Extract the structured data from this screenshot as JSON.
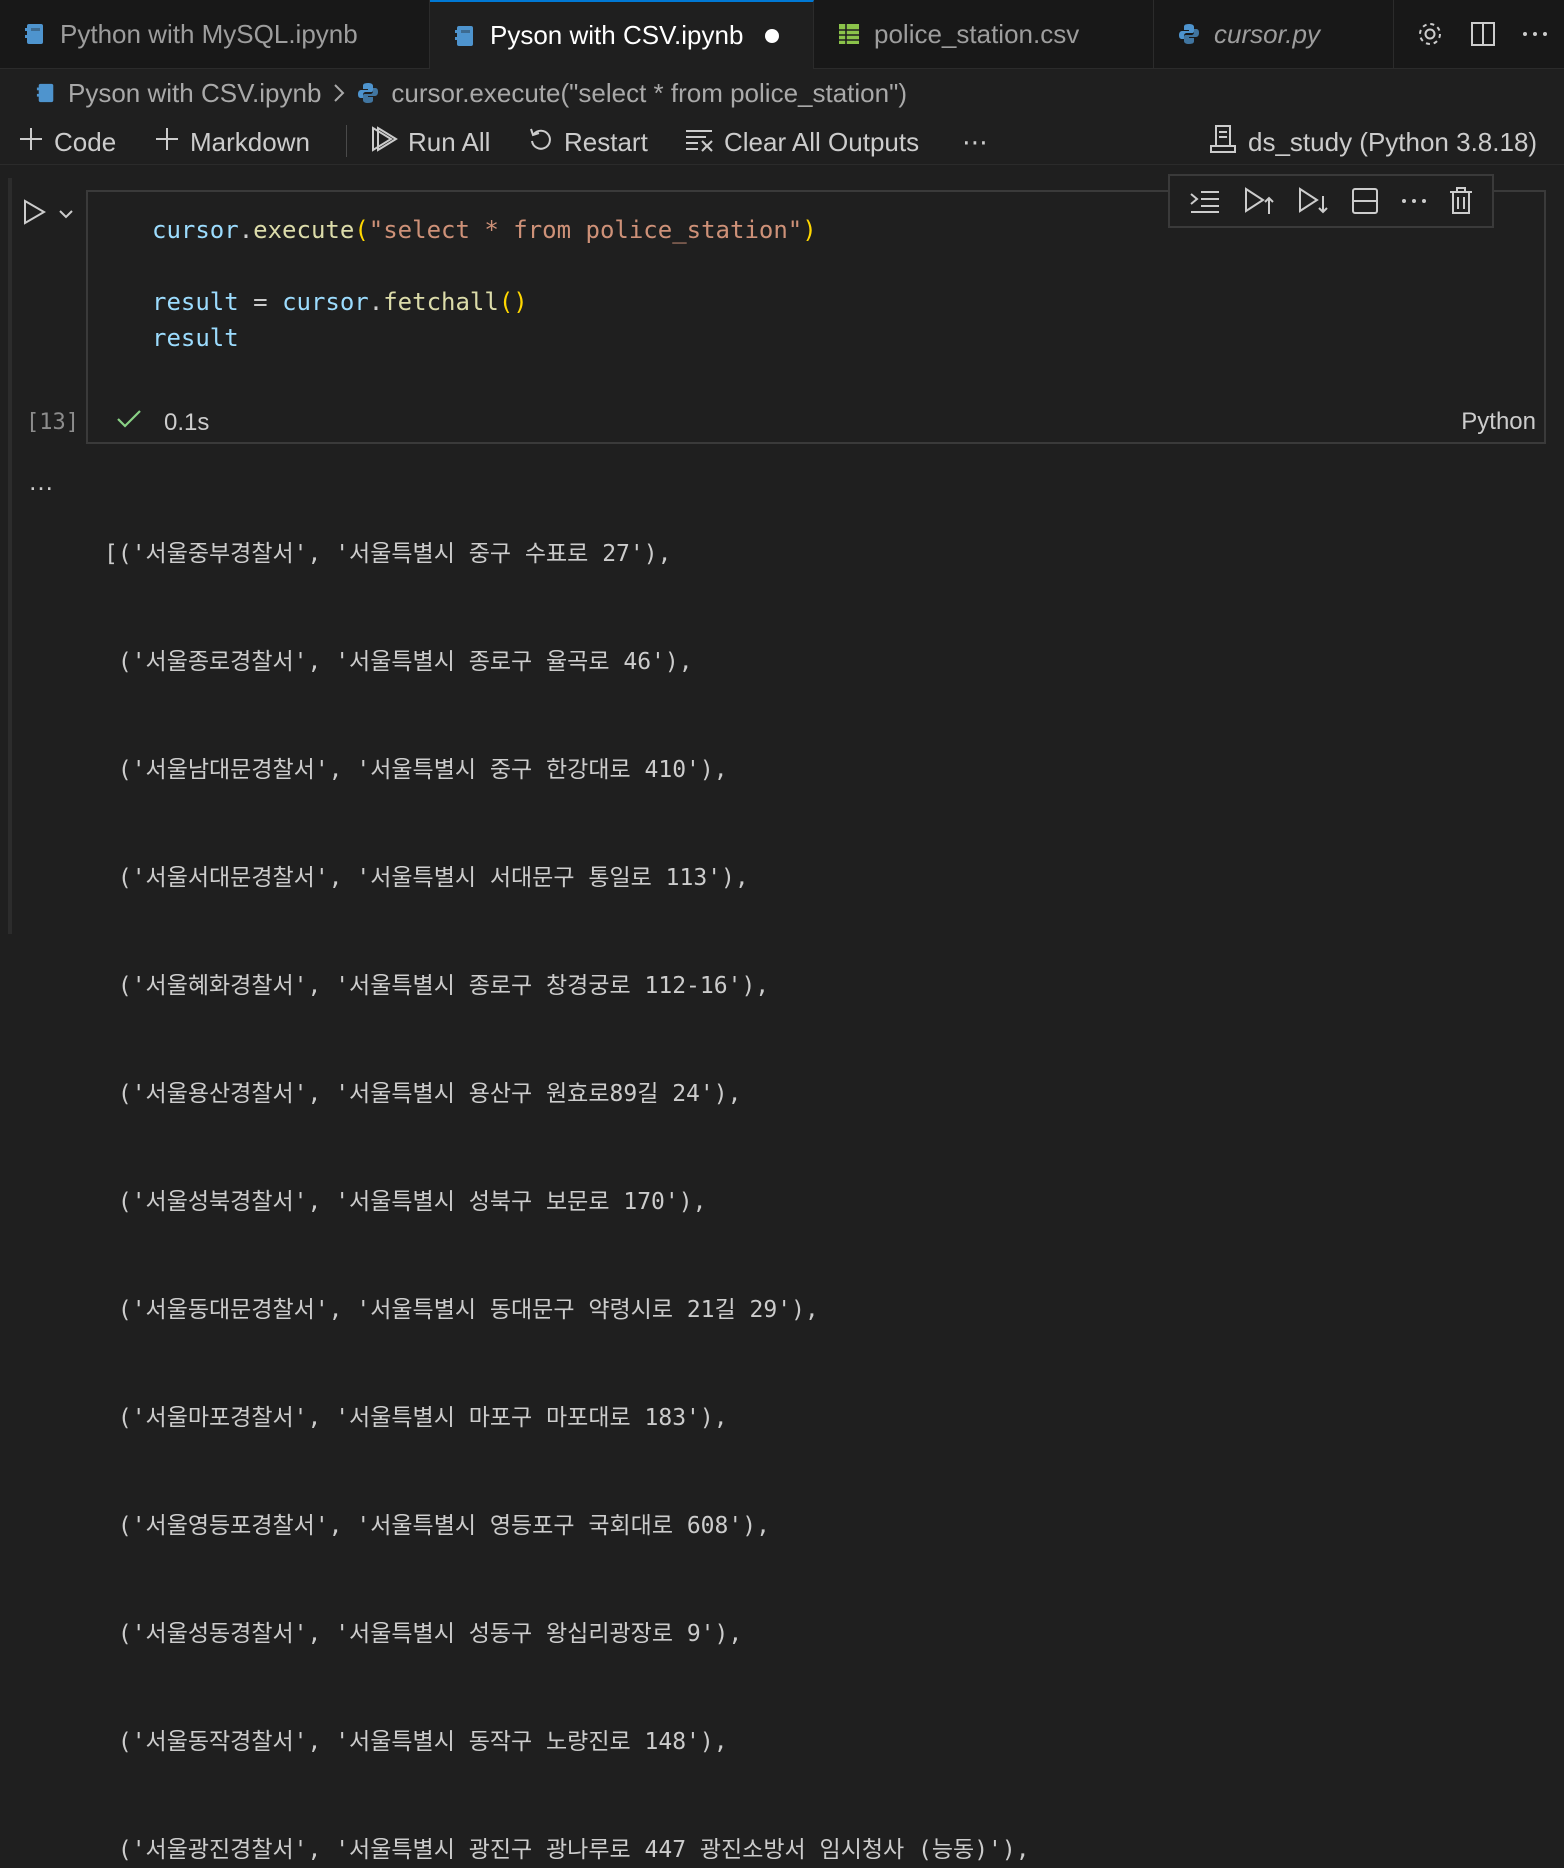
{
  "tabs": [
    {
      "label": "Python with MySQL.ipynb",
      "icon": "notebook-icon",
      "active": false
    },
    {
      "label": "Pyson with CSV.ipynb",
      "icon": "notebook-icon",
      "active": true,
      "dirty": true
    },
    {
      "label": "police_station.csv",
      "icon": "csv-table-icon",
      "active": false
    },
    {
      "label": "cursor.py",
      "icon": "python-icon",
      "active": false,
      "italic": true
    }
  ],
  "tab_actions": [
    "gear-icon",
    "split-editor-icon",
    "more-icon"
  ],
  "breadcrumb": {
    "file": "Pyson with CSV.ipynb",
    "cell": "cursor.execute(\"select * from police_station\")"
  },
  "toolbar": {
    "code": "Code",
    "markdown": "Markdown",
    "run_all": "Run All",
    "restart": "Restart",
    "clear_outputs": "Clear All Outputs",
    "more": "⋯",
    "kernel": "ds_study (Python 3.8.18)"
  },
  "cell": {
    "code_lines": [
      "cursor.execute(\"select * from police_station\")",
      "",
      "result = cursor.fetchall()",
      "result"
    ],
    "execution_count": "[13]",
    "duration": "0.1s",
    "language": "Python",
    "toolbar_icons": [
      "run-by-line-icon",
      "run-above-icon",
      "run-below-icon",
      "split-cell-icon",
      "more-icon",
      "delete-icon"
    ]
  },
  "output": {
    "ellipsis": "…",
    "lines": [
      "[('서울중부경찰서', '서울특별시 중구 수표로 27'),",
      " ('서울종로경찰서', '서울특별시 종로구 율곡로 46'),",
      " ('서울남대문경찰서', '서울특별시 중구 한강대로 410'),",
      " ('서울서대문경찰서', '서울특별시 서대문구 통일로 113'),",
      " ('서울혜화경찰서', '서울특별시 종로구 창경궁로 112-16'),",
      " ('서울용산경찰서', '서울특별시 용산구 원효로89길 24'),",
      " ('서울성북경찰서', '서울특별시 성북구 보문로 170'),",
      " ('서울동대문경찰서', '서울특별시 동대문구 약령시로 21길 29'),",
      " ('서울마포경찰서', '서울특별시 마포구 마포대로 183'),",
      " ('서울영등포경찰서', '서울특별시 영등포구 국회대로 608'),",
      " ('서울성동경찰서', '서울특별시 성동구 왕십리광장로 9'),",
      " ('서울동작경찰서', '서울특별시 동작구 노량진로 148'),",
      " ('서울광진경찰서', '서울특별시 광진구 광나루로 447 광진소방서 임시청사 (능동)'),"
    ]
  },
  "colors": {
    "background": "#1f1f1f",
    "tabbar": "#181818",
    "accent": "#0078d4",
    "success": "#89d185",
    "string": "#ce9178",
    "variable": "#9cdcfe",
    "function": "#dcdcaa"
  }
}
